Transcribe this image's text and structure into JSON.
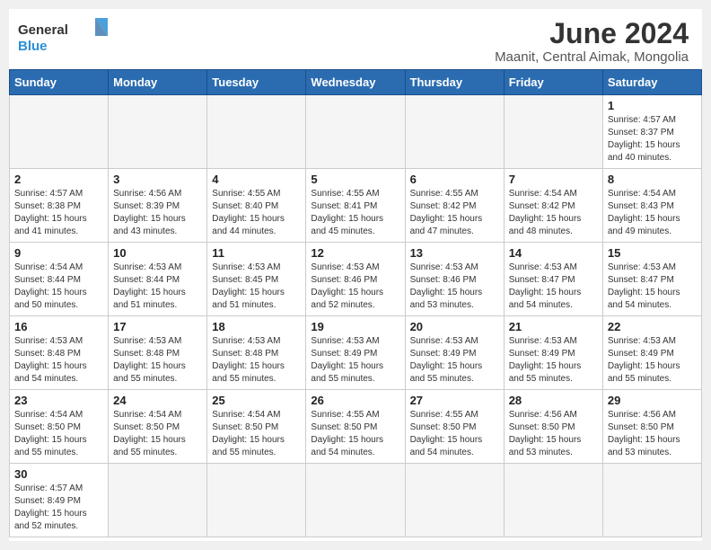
{
  "header": {
    "logo_line1": "General",
    "logo_line2": "Blue",
    "title": "June 2024",
    "subtitle": "Maanit, Central Aimak, Mongolia"
  },
  "days_of_week": [
    "Sunday",
    "Monday",
    "Tuesday",
    "Wednesday",
    "Thursday",
    "Friday",
    "Saturday"
  ],
  "weeks": [
    [
      {
        "day": "",
        "info": ""
      },
      {
        "day": "",
        "info": ""
      },
      {
        "day": "",
        "info": ""
      },
      {
        "day": "",
        "info": ""
      },
      {
        "day": "",
        "info": ""
      },
      {
        "day": "",
        "info": ""
      },
      {
        "day": "1",
        "info": "Sunrise: 4:57 AM\nSunset: 8:37 PM\nDaylight: 15 hours\nand 40 minutes."
      }
    ],
    [
      {
        "day": "2",
        "info": "Sunrise: 4:57 AM\nSunset: 8:38 PM\nDaylight: 15 hours\nand 41 minutes."
      },
      {
        "day": "3",
        "info": "Sunrise: 4:56 AM\nSunset: 8:39 PM\nDaylight: 15 hours\nand 43 minutes."
      },
      {
        "day": "4",
        "info": "Sunrise: 4:55 AM\nSunset: 8:40 PM\nDaylight: 15 hours\nand 44 minutes."
      },
      {
        "day": "5",
        "info": "Sunrise: 4:55 AM\nSunset: 8:41 PM\nDaylight: 15 hours\nand 45 minutes."
      },
      {
        "day": "6",
        "info": "Sunrise: 4:55 AM\nSunset: 8:42 PM\nDaylight: 15 hours\nand 47 minutes."
      },
      {
        "day": "7",
        "info": "Sunrise: 4:54 AM\nSunset: 8:42 PM\nDaylight: 15 hours\nand 48 minutes."
      },
      {
        "day": "8",
        "info": "Sunrise: 4:54 AM\nSunset: 8:43 PM\nDaylight: 15 hours\nand 49 minutes."
      }
    ],
    [
      {
        "day": "9",
        "info": "Sunrise: 4:54 AM\nSunset: 8:44 PM\nDaylight: 15 hours\nand 50 minutes."
      },
      {
        "day": "10",
        "info": "Sunrise: 4:53 AM\nSunset: 8:44 PM\nDaylight: 15 hours\nand 51 minutes."
      },
      {
        "day": "11",
        "info": "Sunrise: 4:53 AM\nSunset: 8:45 PM\nDaylight: 15 hours\nand 51 minutes."
      },
      {
        "day": "12",
        "info": "Sunrise: 4:53 AM\nSunset: 8:46 PM\nDaylight: 15 hours\nand 52 minutes."
      },
      {
        "day": "13",
        "info": "Sunrise: 4:53 AM\nSunset: 8:46 PM\nDaylight: 15 hours\nand 53 minutes."
      },
      {
        "day": "14",
        "info": "Sunrise: 4:53 AM\nSunset: 8:47 PM\nDaylight: 15 hours\nand 54 minutes."
      },
      {
        "day": "15",
        "info": "Sunrise: 4:53 AM\nSunset: 8:47 PM\nDaylight: 15 hours\nand 54 minutes."
      }
    ],
    [
      {
        "day": "16",
        "info": "Sunrise: 4:53 AM\nSunset: 8:48 PM\nDaylight: 15 hours\nand 54 minutes."
      },
      {
        "day": "17",
        "info": "Sunrise: 4:53 AM\nSunset: 8:48 PM\nDaylight: 15 hours\nand 55 minutes."
      },
      {
        "day": "18",
        "info": "Sunrise: 4:53 AM\nSunset: 8:48 PM\nDaylight: 15 hours\nand 55 minutes."
      },
      {
        "day": "19",
        "info": "Sunrise: 4:53 AM\nSunset: 8:49 PM\nDaylight: 15 hours\nand 55 minutes."
      },
      {
        "day": "20",
        "info": "Sunrise: 4:53 AM\nSunset: 8:49 PM\nDaylight: 15 hours\nand 55 minutes."
      },
      {
        "day": "21",
        "info": "Sunrise: 4:53 AM\nSunset: 8:49 PM\nDaylight: 15 hours\nand 55 minutes."
      },
      {
        "day": "22",
        "info": "Sunrise: 4:53 AM\nSunset: 8:49 PM\nDaylight: 15 hours\nand 55 minutes."
      }
    ],
    [
      {
        "day": "23",
        "info": "Sunrise: 4:54 AM\nSunset: 8:50 PM\nDaylight: 15 hours\nand 55 minutes."
      },
      {
        "day": "24",
        "info": "Sunrise: 4:54 AM\nSunset: 8:50 PM\nDaylight: 15 hours\nand 55 minutes."
      },
      {
        "day": "25",
        "info": "Sunrise: 4:54 AM\nSunset: 8:50 PM\nDaylight: 15 hours\nand 55 minutes."
      },
      {
        "day": "26",
        "info": "Sunrise: 4:55 AM\nSunset: 8:50 PM\nDaylight: 15 hours\nand 54 minutes."
      },
      {
        "day": "27",
        "info": "Sunrise: 4:55 AM\nSunset: 8:50 PM\nDaylight: 15 hours\nand 54 minutes."
      },
      {
        "day": "28",
        "info": "Sunrise: 4:56 AM\nSunset: 8:50 PM\nDaylight: 15 hours\nand 53 minutes."
      },
      {
        "day": "29",
        "info": "Sunrise: 4:56 AM\nSunset: 8:50 PM\nDaylight: 15 hours\nand 53 minutes."
      }
    ],
    [
      {
        "day": "30",
        "info": "Sunrise: 4:57 AM\nSunset: 8:49 PM\nDaylight: 15 hours\nand 52 minutes."
      },
      {
        "day": "",
        "info": ""
      },
      {
        "day": "",
        "info": ""
      },
      {
        "day": "",
        "info": ""
      },
      {
        "day": "",
        "info": ""
      },
      {
        "day": "",
        "info": ""
      },
      {
        "day": "",
        "info": ""
      }
    ]
  ]
}
